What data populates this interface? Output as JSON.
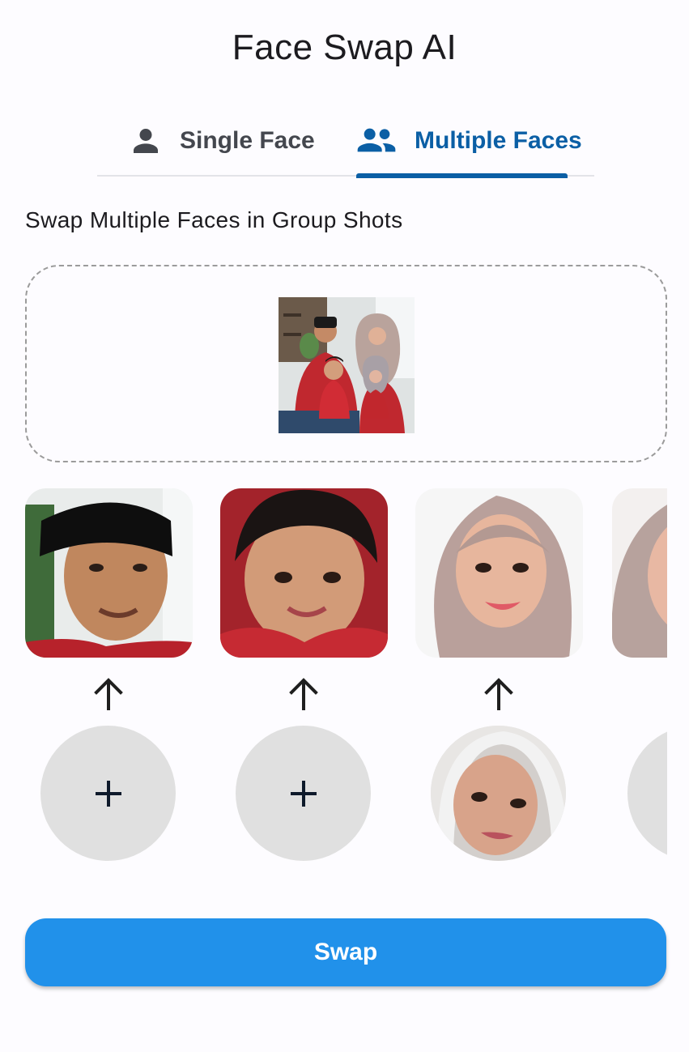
{
  "app": {
    "title": "Face Swap AI"
  },
  "tabs": [
    {
      "label": "Single Face",
      "icon": "person-icon",
      "selected": false
    },
    {
      "label": "Multiple Faces",
      "icon": "group-icon",
      "selected": true
    }
  ],
  "main": {
    "subtitle": "Swap Multiple Faces in Group Shots",
    "dropzone": {
      "image": "group-family-photo"
    },
    "faces": [
      {
        "target": "man-face-photo",
        "source": null,
        "slot_icon": "plus-icon"
      },
      {
        "target": "boy-face-photo",
        "source": null,
        "slot_icon": "plus-icon"
      },
      {
        "target": "woman-face-photo",
        "source": "source-face-photo",
        "slot_icon": null
      },
      {
        "target": "girl-face-photo",
        "source": null,
        "slot_icon": "plus-icon"
      }
    ]
  },
  "actions": {
    "swap_label": "Swap"
  },
  "colors": {
    "accent": "#0b5fa5",
    "button": "#2191ea",
    "slot": "#e0e0e0",
    "background": "#fdfcff"
  }
}
